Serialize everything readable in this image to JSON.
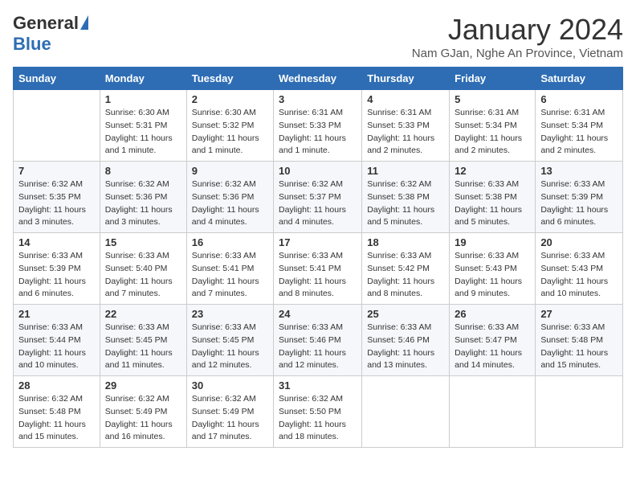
{
  "logo": {
    "general": "General",
    "blue": "Blue"
  },
  "header": {
    "month": "January 2024",
    "location": "Nam GJan, Nghe An Province, Vietnam"
  },
  "weekdays": [
    "Sunday",
    "Monday",
    "Tuesday",
    "Wednesday",
    "Thursday",
    "Friday",
    "Saturday"
  ],
  "weeks": [
    [
      {
        "day": "",
        "sunrise": "",
        "sunset": "",
        "daylight": ""
      },
      {
        "day": "1",
        "sunrise": "Sunrise: 6:30 AM",
        "sunset": "Sunset: 5:31 PM",
        "daylight": "Daylight: 11 hours and 1 minute."
      },
      {
        "day": "2",
        "sunrise": "Sunrise: 6:30 AM",
        "sunset": "Sunset: 5:32 PM",
        "daylight": "Daylight: 11 hours and 1 minute."
      },
      {
        "day": "3",
        "sunrise": "Sunrise: 6:31 AM",
        "sunset": "Sunset: 5:33 PM",
        "daylight": "Daylight: 11 hours and 1 minute."
      },
      {
        "day": "4",
        "sunrise": "Sunrise: 6:31 AM",
        "sunset": "Sunset: 5:33 PM",
        "daylight": "Daylight: 11 hours and 2 minutes."
      },
      {
        "day": "5",
        "sunrise": "Sunrise: 6:31 AM",
        "sunset": "Sunset: 5:34 PM",
        "daylight": "Daylight: 11 hours and 2 minutes."
      },
      {
        "day": "6",
        "sunrise": "Sunrise: 6:31 AM",
        "sunset": "Sunset: 5:34 PM",
        "daylight": "Daylight: 11 hours and 2 minutes."
      }
    ],
    [
      {
        "day": "7",
        "sunrise": "Sunrise: 6:32 AM",
        "sunset": "Sunset: 5:35 PM",
        "daylight": "Daylight: 11 hours and 3 minutes."
      },
      {
        "day": "8",
        "sunrise": "Sunrise: 6:32 AM",
        "sunset": "Sunset: 5:36 PM",
        "daylight": "Daylight: 11 hours and 3 minutes."
      },
      {
        "day": "9",
        "sunrise": "Sunrise: 6:32 AM",
        "sunset": "Sunset: 5:36 PM",
        "daylight": "Daylight: 11 hours and 4 minutes."
      },
      {
        "day": "10",
        "sunrise": "Sunrise: 6:32 AM",
        "sunset": "Sunset: 5:37 PM",
        "daylight": "Daylight: 11 hours and 4 minutes."
      },
      {
        "day": "11",
        "sunrise": "Sunrise: 6:32 AM",
        "sunset": "Sunset: 5:38 PM",
        "daylight": "Daylight: 11 hours and 5 minutes."
      },
      {
        "day": "12",
        "sunrise": "Sunrise: 6:33 AM",
        "sunset": "Sunset: 5:38 PM",
        "daylight": "Daylight: 11 hours and 5 minutes."
      },
      {
        "day": "13",
        "sunrise": "Sunrise: 6:33 AM",
        "sunset": "Sunset: 5:39 PM",
        "daylight": "Daylight: 11 hours and 6 minutes."
      }
    ],
    [
      {
        "day": "14",
        "sunrise": "Sunrise: 6:33 AM",
        "sunset": "Sunset: 5:39 PM",
        "daylight": "Daylight: 11 hours and 6 minutes."
      },
      {
        "day": "15",
        "sunrise": "Sunrise: 6:33 AM",
        "sunset": "Sunset: 5:40 PM",
        "daylight": "Daylight: 11 hours and 7 minutes."
      },
      {
        "day": "16",
        "sunrise": "Sunrise: 6:33 AM",
        "sunset": "Sunset: 5:41 PM",
        "daylight": "Daylight: 11 hours and 7 minutes."
      },
      {
        "day": "17",
        "sunrise": "Sunrise: 6:33 AM",
        "sunset": "Sunset: 5:41 PM",
        "daylight": "Daylight: 11 hours and 8 minutes."
      },
      {
        "day": "18",
        "sunrise": "Sunrise: 6:33 AM",
        "sunset": "Sunset: 5:42 PM",
        "daylight": "Daylight: 11 hours and 8 minutes."
      },
      {
        "day": "19",
        "sunrise": "Sunrise: 6:33 AM",
        "sunset": "Sunset: 5:43 PM",
        "daylight": "Daylight: 11 hours and 9 minutes."
      },
      {
        "day": "20",
        "sunrise": "Sunrise: 6:33 AM",
        "sunset": "Sunset: 5:43 PM",
        "daylight": "Daylight: 11 hours and 10 minutes."
      }
    ],
    [
      {
        "day": "21",
        "sunrise": "Sunrise: 6:33 AM",
        "sunset": "Sunset: 5:44 PM",
        "daylight": "Daylight: 11 hours and 10 minutes."
      },
      {
        "day": "22",
        "sunrise": "Sunrise: 6:33 AM",
        "sunset": "Sunset: 5:45 PM",
        "daylight": "Daylight: 11 hours and 11 minutes."
      },
      {
        "day": "23",
        "sunrise": "Sunrise: 6:33 AM",
        "sunset": "Sunset: 5:45 PM",
        "daylight": "Daylight: 11 hours and 12 minutes."
      },
      {
        "day": "24",
        "sunrise": "Sunrise: 6:33 AM",
        "sunset": "Sunset: 5:46 PM",
        "daylight": "Daylight: 11 hours and 12 minutes."
      },
      {
        "day": "25",
        "sunrise": "Sunrise: 6:33 AM",
        "sunset": "Sunset: 5:46 PM",
        "daylight": "Daylight: 11 hours and 13 minutes."
      },
      {
        "day": "26",
        "sunrise": "Sunrise: 6:33 AM",
        "sunset": "Sunset: 5:47 PM",
        "daylight": "Daylight: 11 hours and 14 minutes."
      },
      {
        "day": "27",
        "sunrise": "Sunrise: 6:33 AM",
        "sunset": "Sunset: 5:48 PM",
        "daylight": "Daylight: 11 hours and 15 minutes."
      }
    ],
    [
      {
        "day": "28",
        "sunrise": "Sunrise: 6:32 AM",
        "sunset": "Sunset: 5:48 PM",
        "daylight": "Daylight: 11 hours and 15 minutes."
      },
      {
        "day": "29",
        "sunrise": "Sunrise: 6:32 AM",
        "sunset": "Sunset: 5:49 PM",
        "daylight": "Daylight: 11 hours and 16 minutes."
      },
      {
        "day": "30",
        "sunrise": "Sunrise: 6:32 AM",
        "sunset": "Sunset: 5:49 PM",
        "daylight": "Daylight: 11 hours and 17 minutes."
      },
      {
        "day": "31",
        "sunrise": "Sunrise: 6:32 AM",
        "sunset": "Sunset: 5:50 PM",
        "daylight": "Daylight: 11 hours and 18 minutes."
      },
      {
        "day": "",
        "sunrise": "",
        "sunset": "",
        "daylight": ""
      },
      {
        "day": "",
        "sunrise": "",
        "sunset": "",
        "daylight": ""
      },
      {
        "day": "",
        "sunrise": "",
        "sunset": "",
        "daylight": ""
      }
    ]
  ]
}
